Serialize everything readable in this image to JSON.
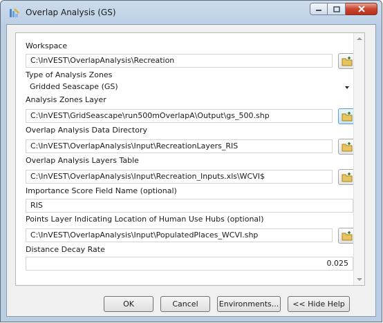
{
  "window": {
    "title": "Overlap Analysis (GS)"
  },
  "form": {
    "workspace": {
      "label": "Workspace",
      "value": "C:\\InVEST\\OverlapAnalysis\\Recreation"
    },
    "zone_type": {
      "label": "Type of Analysis Zones",
      "value": "Gridded Seascape (GS)"
    },
    "zones_layer": {
      "label": "Analysis Zones Layer",
      "value": "C:\\InVEST\\GridSeascape\\run500mOverlapA\\Output\\gs_500.shp"
    },
    "data_dir": {
      "label": "Overlap Analysis Data Directory",
      "value": "C:\\InVEST\\OverlapAnalysis\\Input\\RecreationLayers_RIS"
    },
    "layers_table": {
      "label": "Overlap Analysis Layers Table",
      "value": "C:\\InVEST\\OverlapAnalysis\\Input\\Recreation_Inputs.xls\\WCVI$"
    },
    "importance_field": {
      "label": "Importance Score Field Name (optional)",
      "value": "RIS"
    },
    "hubs_layer": {
      "label": "Points Layer Indicating Location of Human Use Hubs (optional)",
      "value": "C:\\InVEST\\OverlapAnalysis\\Input\\PopulatedPlaces_WCVI.shp"
    },
    "decay_rate": {
      "label": "Distance Decay Rate",
      "value": "0.025"
    }
  },
  "buttons": {
    "ok": "OK",
    "cancel": "Cancel",
    "environments": "Environments...",
    "hide_help": "<< Hide Help"
  }
}
